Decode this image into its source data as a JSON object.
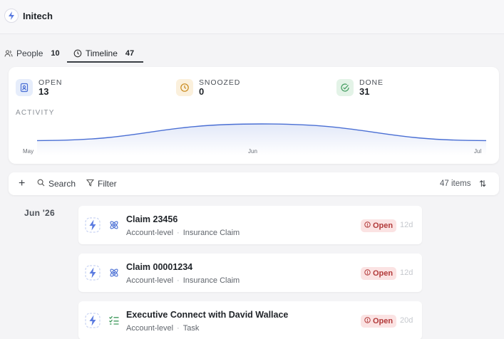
{
  "app": {
    "name": "Initech"
  },
  "tabs": [
    {
      "label": "People",
      "count": "10",
      "icon": "people-icon"
    },
    {
      "label": "Timeline",
      "count": "47",
      "icon": "clock-icon",
      "active": true
    }
  ],
  "summary": {
    "stats": [
      {
        "label": "OPEN",
        "value": "13",
        "icon": "contact-card-icon",
        "color": "#4a6fd4",
        "bg": "#e6edfb"
      },
      {
        "label": "SNOOZED",
        "value": "0",
        "icon": "clock-icon",
        "color": "#c98a1d",
        "bg": "#fbf0dc"
      },
      {
        "label": "DONE",
        "value": "31",
        "icon": "check-circle-icon",
        "color": "#3f9a5c",
        "bg": "#e3f3e7"
      }
    ],
    "activity_label": "ACTIVITY"
  },
  "chart_data": {
    "type": "area",
    "x": [
      "May",
      "Jun",
      "Jul"
    ],
    "xlabel": "",
    "ylabel": "",
    "series": [
      {
        "values": [
          0.1,
          1.0,
          0.1
        ]
      }
    ],
    "color": "#4a6fd4",
    "grid": false
  },
  "toolbar": {
    "add_label": "+",
    "search_label": "Search",
    "filter_label": "Filter",
    "items_count": "47 items",
    "sort_label": "⇅"
  },
  "timeline": {
    "group_label": "Jun '26",
    "cards": [
      {
        "title": "Claim 23456",
        "scope": "Account-level",
        "type": "Insurance Claim",
        "type_icon": "atom-icon",
        "status": "Open",
        "age": "12d"
      },
      {
        "title": "Claim 00001234",
        "scope": "Account-level",
        "type": "Insurance Claim",
        "type_icon": "atom-icon",
        "status": "Open",
        "age": "12d"
      },
      {
        "title": "Executive Connect with David Wallace",
        "scope": "Account-level",
        "type": "Task",
        "type_icon": "checklist-icon",
        "status": "Open",
        "age": "20d"
      }
    ]
  }
}
